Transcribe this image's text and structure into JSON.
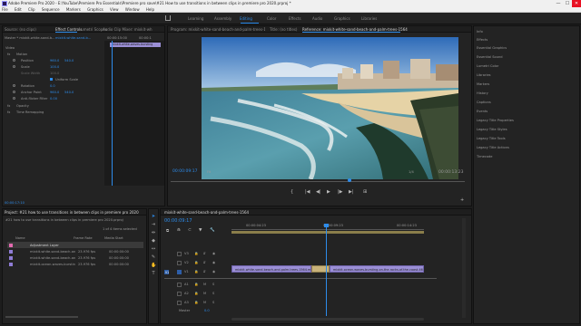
{
  "window": {
    "title": "Adobe Premiere Pro 2020 - E:\\YouTube\\Premiere Pro Essentials\\Premiere pro save\\#21 How to use transitions in between clips in premiere pro 2020.prproj *",
    "min": "—",
    "max": "☐",
    "close": "✕"
  },
  "menu": [
    "File",
    "Edit",
    "Clip",
    "Sequence",
    "Markers",
    "Graphics",
    "View",
    "Window",
    "Help"
  ],
  "workspaces": {
    "items": [
      "Learning",
      "Assembly",
      "Editing",
      "Color",
      "Effects",
      "Audio",
      "Graphics",
      "Libraries"
    ],
    "active": "Editing"
  },
  "source_panel": {
    "tabs": [
      "Source: (no clips)",
      "Effect Controls",
      "Lumetri Scopes",
      "Audio Clip Mixer: mixkit-wh"
    ],
    "active_tab": "Effect Controls",
    "master": "Master * mixkit-white-sand-b...",
    "clip_ref": "mixkit-white-sand-b...",
    "timecode_a": "00:00:15:00",
    "timecode_b": "00:00:1",
    "mini_clip": "mixkit-white-waves-bursting",
    "section_video": "Video",
    "motion": "Motion",
    "position_label": "Position",
    "position_x": "960.0",
    "position_y": "540.0",
    "scale_label": "Scale",
    "scale_value": "100.0",
    "scale_width_label": "Scale Width",
    "scale_width_value": "100.0",
    "uniform_label": "Uniform Scale",
    "rotation_label": "Rotation",
    "rotation_value": "0.0",
    "anchor_label": "Anchor Point",
    "anchor_x": "960.0",
    "anchor_y": "540.0",
    "flicker_label": "Anti-flicker Filter",
    "flicker_value": "0.00",
    "opacity": "Opacity",
    "time_remap": "Time Remapping",
    "footer_time": "00:00:17:10"
  },
  "program": {
    "tabs": [
      "Program: mixkit-white-sand-beach-and-palm-trees-1564",
      "Title: (no titles)",
      "Reference: mixkit-white-sand-beach-and-palm-trees-1564"
    ],
    "active_tab": "Reference: mixkit-white-sand-beach-and-palm-trees-1564",
    "timecode_in": "00:00:09:17",
    "fit": "Fit",
    "fraction": "1/4",
    "timecode_out": "00:00:13:23",
    "controls": [
      "{",
      "|◀",
      "◀|",
      "▶",
      "|▶",
      "▶|",
      "⊞"
    ]
  },
  "project": {
    "tab": "Project: #21 how to use transitions in between clips in premiere pro 2020",
    "file": "#21 how to use transitions in between clips in premiere pro 2020.prproj",
    "count": "1 of 4 items selected",
    "col_name": "Name",
    "col_rate": "Frame Rate",
    "col_media": "Media Start",
    "rows": [
      {
        "name": "Adjustment Layer",
        "rate": "",
        "start": "",
        "color": "#e36ab0"
      },
      {
        "name": "mixkit-white-sand-beach-and",
        "rate": "23.976 fps",
        "start": "00:00:00:00",
        "color": "#8f7cd6"
      },
      {
        "name": "mixkit-white-sand-beach-and",
        "rate": "23.976 fps",
        "start": "00:00:00:00",
        "color": "#8f7cd6"
      },
      {
        "name": "mixkit-ocean-waves-bursting",
        "rate": "23.976 fps",
        "start": "00:00:00:00",
        "color": "#8f7cd6"
      }
    ]
  },
  "timeline": {
    "tab": "mixkit-white-sand-beach-and-palm-trees-1564",
    "timecode": "00:00:09:17",
    "ruler": [
      "00:00:04:23",
      "00:00:09:23",
      "00:00:14:23"
    ],
    "video_tracks": [
      "V3",
      "V2",
      "V1"
    ],
    "audio_tracks": [
      "A1",
      "A2",
      "A3"
    ],
    "master_label": "Master",
    "master_value": "0.0",
    "clip_a": "mixkit-white-sand-beach-and-palm-trees-1564.mp4",
    "clip_b": "mixkit-ocean-waves-bursting-on-the-rocks-of-the-coast-4679.mov"
  },
  "right_panel": {
    "items": [
      "Info",
      "Effects",
      "Essential Graphics",
      "Essential Sound",
      "Lumetri Color",
      "Libraries",
      "Markers",
      "History",
      "Captions",
      "Events",
      "Legacy Title Properties",
      "Legacy Title Styles",
      "Legacy Title Tools",
      "Legacy Title Actions",
      "Timecode"
    ]
  },
  "colors": {
    "accent": "#2d8ceb",
    "clip_video": "#9b8fd6",
    "playhead": "#2d8ceb"
  }
}
